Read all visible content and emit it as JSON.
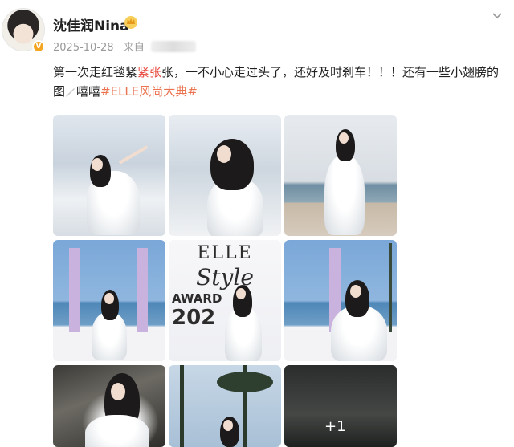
{
  "user": {
    "name": "沈佳润Nina",
    "verified_badge": "V"
  },
  "meta": {
    "date": "2025-10-28",
    "source_prefix": "来自"
  },
  "post": {
    "text_before_hl": "第一次走红毯紧",
    "text_hl": "紧张",
    "text_after_hl": "张，一不小心走过头了，还好及时刹车！！！还有一些小翅膀的图",
    "text_after_icon": "嘻嘻",
    "hashtag": "#ELLE风尚大典#"
  },
  "grid": {
    "elle_top": "ELLE",
    "elle_style": "Style",
    "elle_award": "AWARD",
    "elle_year": "202",
    "more_count": "+1"
  },
  "colors": {
    "highlight": "#e8483f",
    "hashtag": "#eb7350",
    "verify": "#f4a623"
  }
}
